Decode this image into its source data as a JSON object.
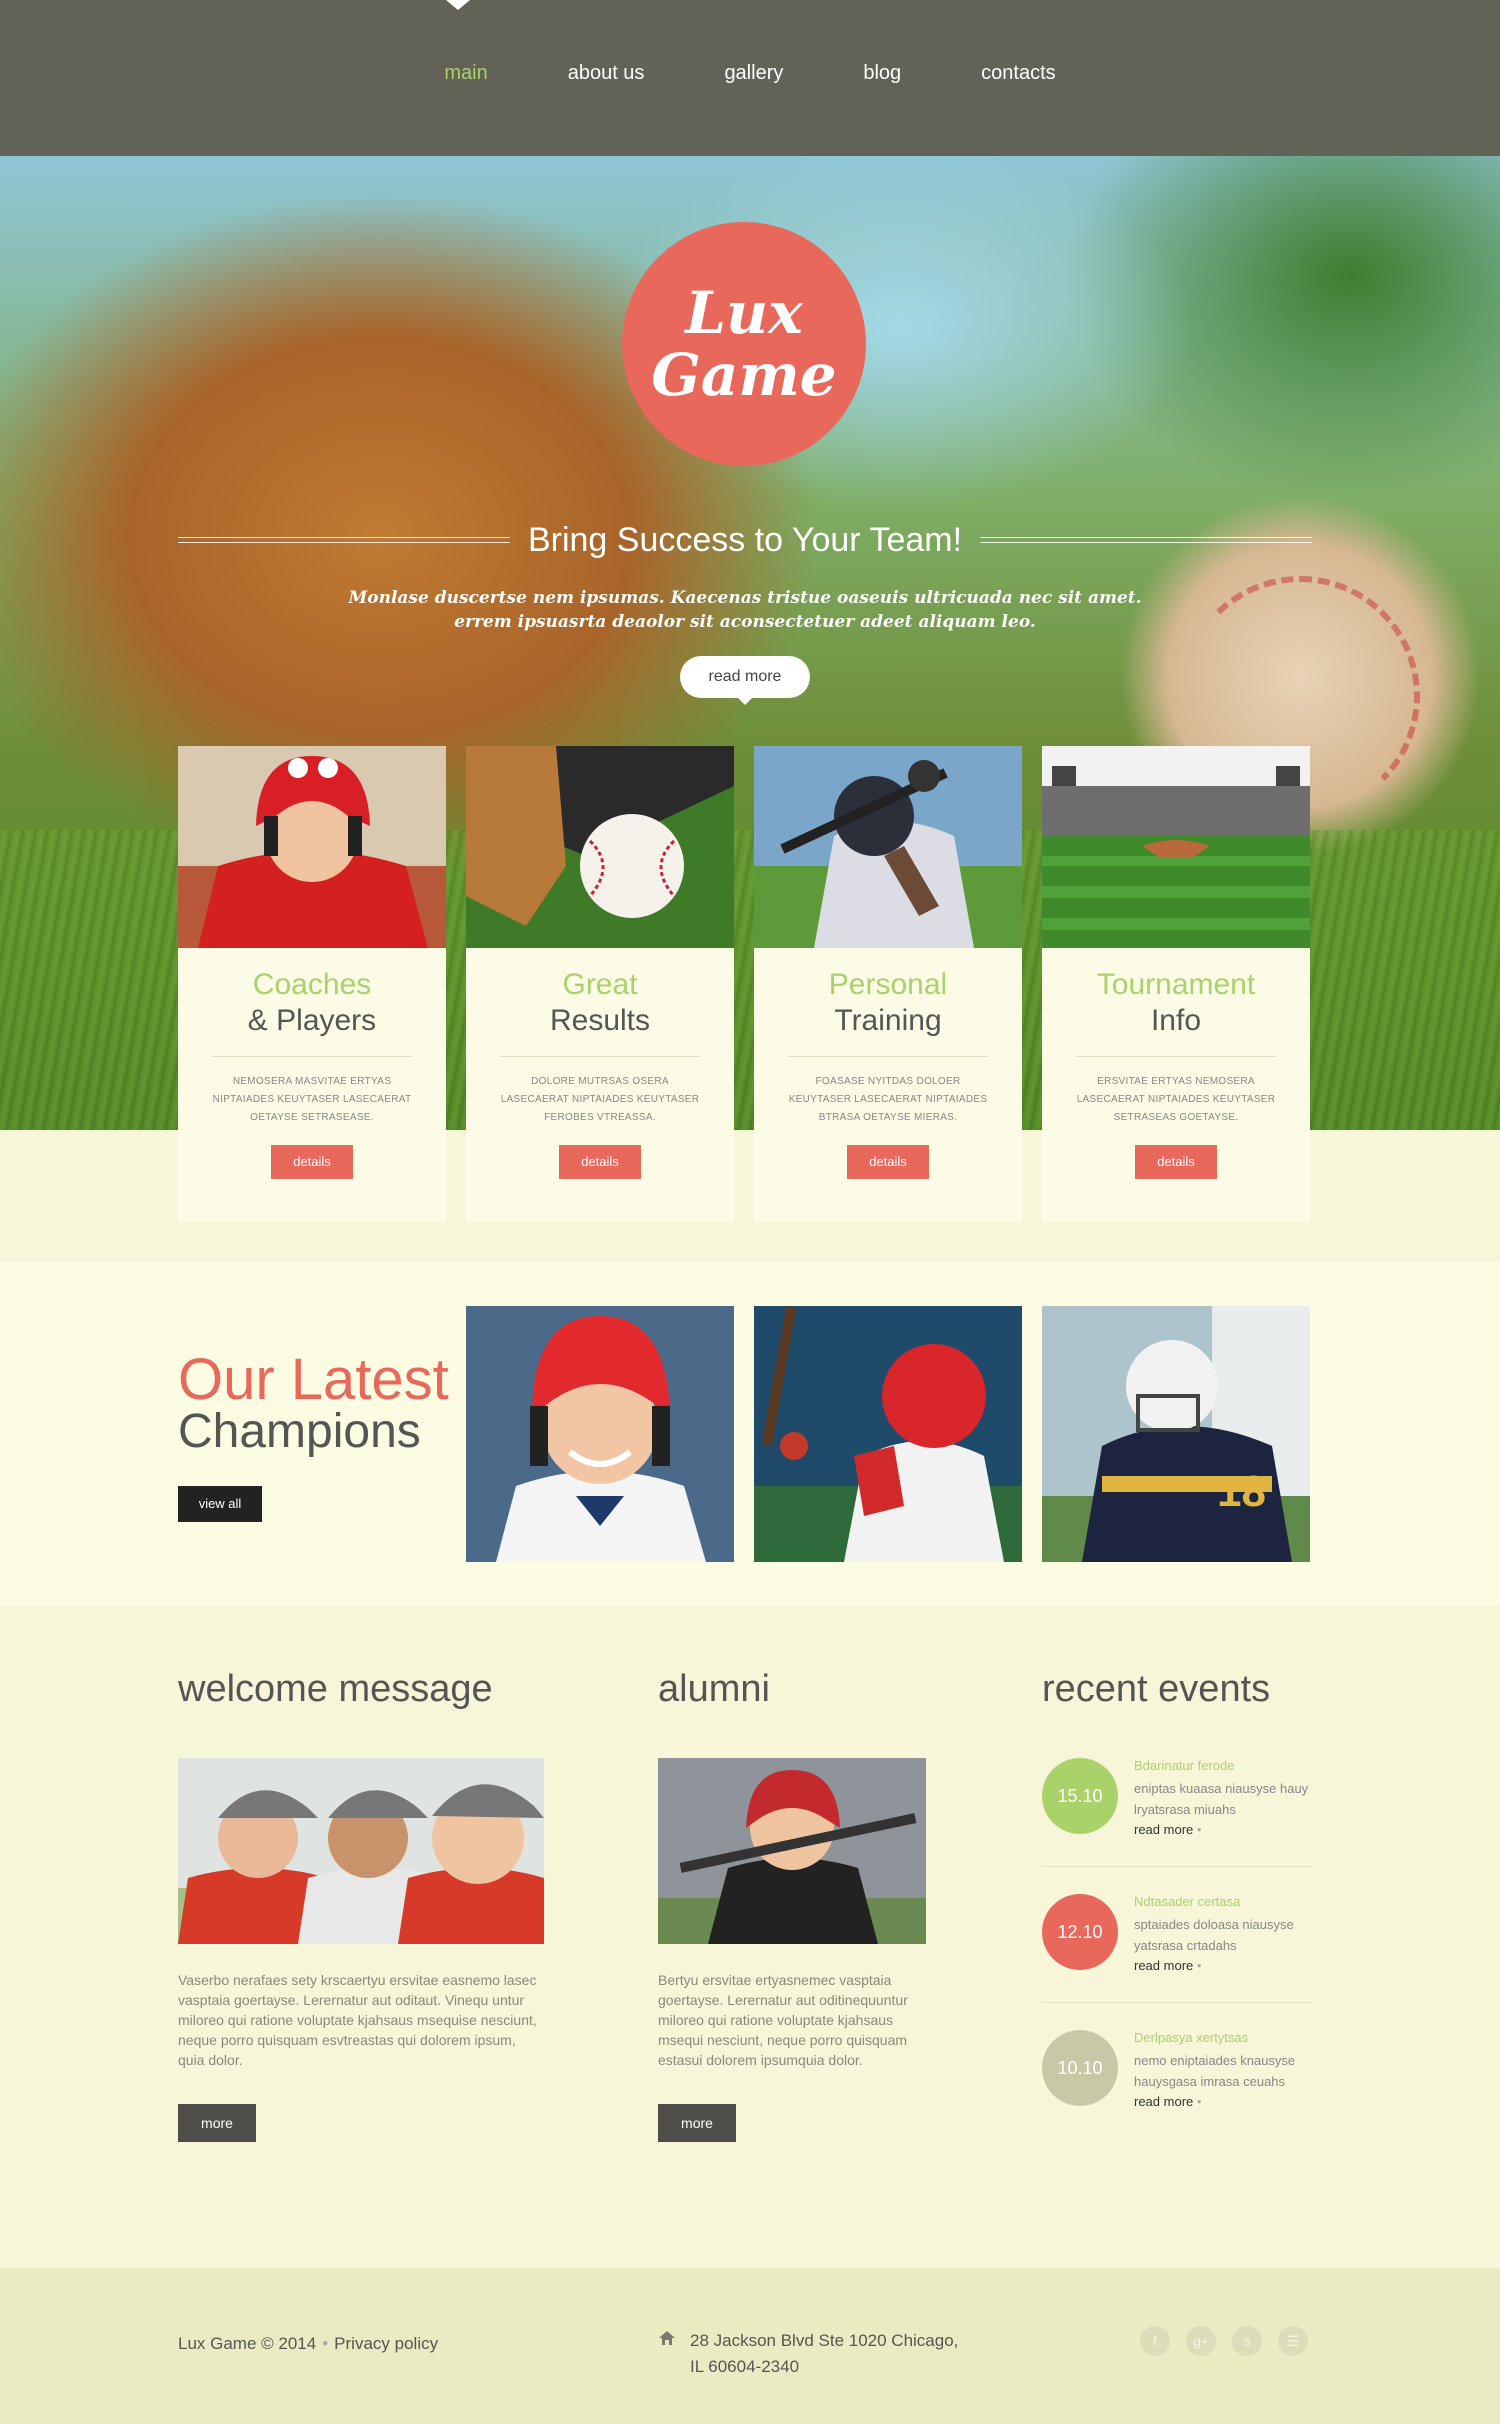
{
  "nav": {
    "items": [
      {
        "label": "main",
        "active": true
      },
      {
        "label": "about us"
      },
      {
        "label": "gallery"
      },
      {
        "label": "blog"
      },
      {
        "label": "contacts"
      }
    ]
  },
  "hero": {
    "logo_line1": "Lux",
    "logo_line2": "Game",
    "tagline": "Bring Success to Your Team!",
    "subtitle_line1": "Monlase duscertse nem ipsumas. Kaecenas tristue oaseuis ultricuada nec sit amet.",
    "subtitle_line2": "errem ipsuasrta deaolor sit aconsectetuer adeet aliquam leo.",
    "button": "read more"
  },
  "cards": [
    {
      "title1": "Coaches",
      "title2": "& Players",
      "text": "NEMOSERA MASVITAE ERTYAS NIPTAIADES KEUYTASER LASECAERAT OETAYSE SETRASEASE.",
      "button": "details"
    },
    {
      "title1": "Great",
      "title2": "Results",
      "text": "DOLORE MUTRSAS OSERA LASECAERAT NIPTAIADES KEUYTASER FEROBES VTREASSA.",
      "button": "details"
    },
    {
      "title1": "Personal",
      "title2": "Training",
      "text": "FOASASE NYITDAS DOLOER KEUYTASER LASECAERAT NIPTAIADES BTRASA OETAYSE MIERAS.",
      "button": "details"
    },
    {
      "title1": "Tournament",
      "title2": "Info",
      "text": "ERSVITAE ERTYAS NEMOSERA LASECAERAT NIPTAIADES KEUYTASER SETRASEAS GOETAYSE.",
      "button": "details"
    }
  ],
  "champions": {
    "title1": "Our Latest",
    "title2": "Champions",
    "button": "view all",
    "photos": [
      {
        "jersey": ""
      },
      {
        "jersey": ""
      },
      {
        "jersey": "18"
      }
    ]
  },
  "welcome": {
    "title": "welcome message",
    "text": "Vaserbo nerafaes sety krscaertyu ersvitae easnemo lasec vasptaia goertayse. Lerernatur aut oditaut. Vinequ untur miloreo qui ratione voluptate kjahsaus msequise nesciunt, neque porro quisquam esvtreastas qui dolorem ipsum, quia dolor.",
    "button": "more"
  },
  "alumni": {
    "title": "alumni",
    "text": "Bertyu ersvitae ertyasnemec vasptaia goertayse. Lerernatur aut oditinequuntur miloreo qui ratione voluptate kjahsaus msequi nesciunt, neque porro quisquam estasui dolorem ipsumquia dolor.",
    "button": "more"
  },
  "events": {
    "title": "recent events",
    "items": [
      {
        "date": "15.10",
        "color": "#a9d26b",
        "title": "Bdarinatur ferode",
        "text": "eniptas kuaasa niausyse hauy lryatsrasa miuahs",
        "more": "read more"
      },
      {
        "date": "12.10",
        "color": "#e8685c",
        "title": "Ndtasader certasa",
        "text": "sptaiades doloasa niausyse yatsrasa crtadahs",
        "more": "read more"
      },
      {
        "date": "10.10",
        "color": "#c9c8a6",
        "title": "Derlpasya xertytsas",
        "text": "nemo eniptaiades knausyse hauysgasa imrasa ceuahs",
        "more": "read more"
      }
    ]
  },
  "footer": {
    "copyright": "Lux Game © 2014",
    "privacy": "Privacy policy",
    "address_line1": "28 Jackson Blvd Ste 1020 Chicago,",
    "address_line2": "IL 60604-2340",
    "social": [
      {
        "icon": "facebook-icon",
        "glyph": "f"
      },
      {
        "icon": "google-plus-icon",
        "glyph": "g+"
      },
      {
        "icon": "skype-icon",
        "glyph": "s"
      },
      {
        "icon": "rss-icon",
        "glyph": "☰"
      }
    ]
  },
  "colors": {
    "accent_green": "#a9d26b",
    "accent_coral": "#e8685c",
    "nav_bg": "#626256",
    "page_bg": "#f7f6d9"
  }
}
